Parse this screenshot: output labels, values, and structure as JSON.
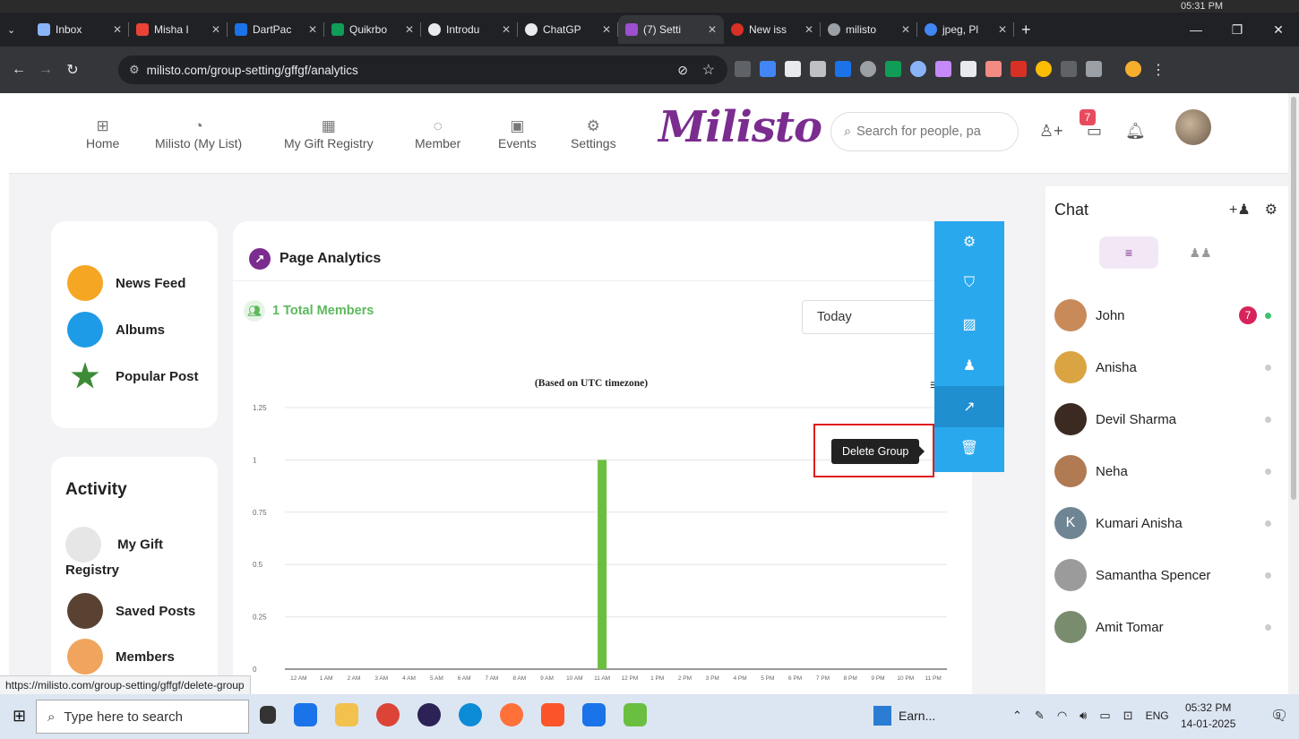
{
  "browser": {
    "top_clock": "05:31 PM",
    "tabs": [
      {
        "label": "Inbox",
        "color": "#8ab4f8"
      },
      {
        "label": "Misha I",
        "color": "#ea4335"
      },
      {
        "label": "DartPac",
        "color": "#1a73e8"
      },
      {
        "label": "Quikrbo",
        "color": "#0f9d58"
      },
      {
        "label": "Introdu",
        "color": "#e8eaed"
      },
      {
        "label": "ChatGP",
        "color": "#e8eaed"
      },
      {
        "label": "(7) Setti",
        "color": "#9c4fd1"
      },
      {
        "label": "New iss",
        "color": "#d93025"
      },
      {
        "label": "milisto",
        "color": "#9aa0a6"
      },
      {
        "label": "jpeg, Pl",
        "color": "#4285f4"
      }
    ],
    "url": "milisto.com/group-setting/gffgf/analytics",
    "status_url": "https://milisto.com/group-setting/gffgf/delete-group"
  },
  "header": {
    "nav": [
      {
        "label": "Home",
        "icon": "grid-icon"
      },
      {
        "label": "Milisto (My List)",
        "icon": "pie-chart-icon"
      },
      {
        "label": "My Gift Registry",
        "icon": "qr-icon"
      },
      {
        "label": "Member",
        "icon": "chat-bubble-icon"
      },
      {
        "label": "Events",
        "icon": "calendar-icon"
      },
      {
        "label": "Settings",
        "icon": "gear-icon"
      }
    ],
    "logo": "Milisto",
    "search_placeholder": "Search for people, pa",
    "messages_badge": "7"
  },
  "sidebar": {
    "menu": [
      {
        "label": "News Feed",
        "color": "#f5a623"
      },
      {
        "label": "Albums",
        "color": "#1e9be6"
      },
      {
        "label": "Popular Post",
        "color": "#3d8b37"
      }
    ],
    "activity_title": "Activity",
    "activity": [
      {
        "label": "My Gift",
        "label2": "Registry"
      },
      {
        "label": "Saved Posts"
      },
      {
        "label": "Members"
      }
    ]
  },
  "analytics": {
    "title": "Page Analytics",
    "members_label": "1 Total Members",
    "range": "Today",
    "tooltip": "Delete Group"
  },
  "chart_data": {
    "type": "bar",
    "title": "(Based on UTC timezone)",
    "categories": [
      "12 AM",
      "1 AM",
      "2 AM",
      "3 AM",
      "4 AM",
      "5 AM",
      "6 AM",
      "7 AM",
      "8 AM",
      "9 AM",
      "10 AM",
      "11 AM",
      "12 PM",
      "1 PM",
      "2 PM",
      "3 PM",
      "4 PM",
      "5 PM",
      "6 PM",
      "7 PM",
      "8 PM",
      "9 PM",
      "10 PM",
      "11 PM"
    ],
    "values": [
      0,
      0,
      0,
      0,
      0,
      0,
      0,
      0,
      0,
      0,
      0,
      1,
      0,
      0,
      0,
      0,
      0,
      0,
      0,
      0,
      0,
      0,
      0,
      0
    ],
    "ylim": [
      0,
      1.25
    ],
    "yticks": [
      "1.25",
      "1",
      "0.75",
      "0.5",
      "0.25",
      "0"
    ],
    "color": "#6abf40",
    "grid": true
  },
  "chat": {
    "title": "Chat",
    "contacts": [
      {
        "name": "John",
        "badge": "7",
        "online": true,
        "color": "#c98a5a"
      },
      {
        "name": "Anisha",
        "online": false,
        "color": "#d9a441"
      },
      {
        "name": "Devil Sharma",
        "online": false,
        "color": "#3b2a22"
      },
      {
        "name": "Neha",
        "online": false,
        "color": "#b07a52"
      },
      {
        "name": "Kumari Anisha",
        "initial": "K",
        "online": false,
        "color": "#6f8594"
      },
      {
        "name": "Samantha Spencer",
        "online": false,
        "color": "#9b9b9b"
      },
      {
        "name": "Amit Tomar",
        "online": false,
        "color": "#7a8c6e"
      }
    ]
  },
  "taskbar": {
    "search_placeholder": "Type here to search",
    "app_label": "Earn...",
    "lang": "ENG",
    "time": "05:32 PM",
    "date": "14-01-2025",
    "notifications": "9"
  }
}
